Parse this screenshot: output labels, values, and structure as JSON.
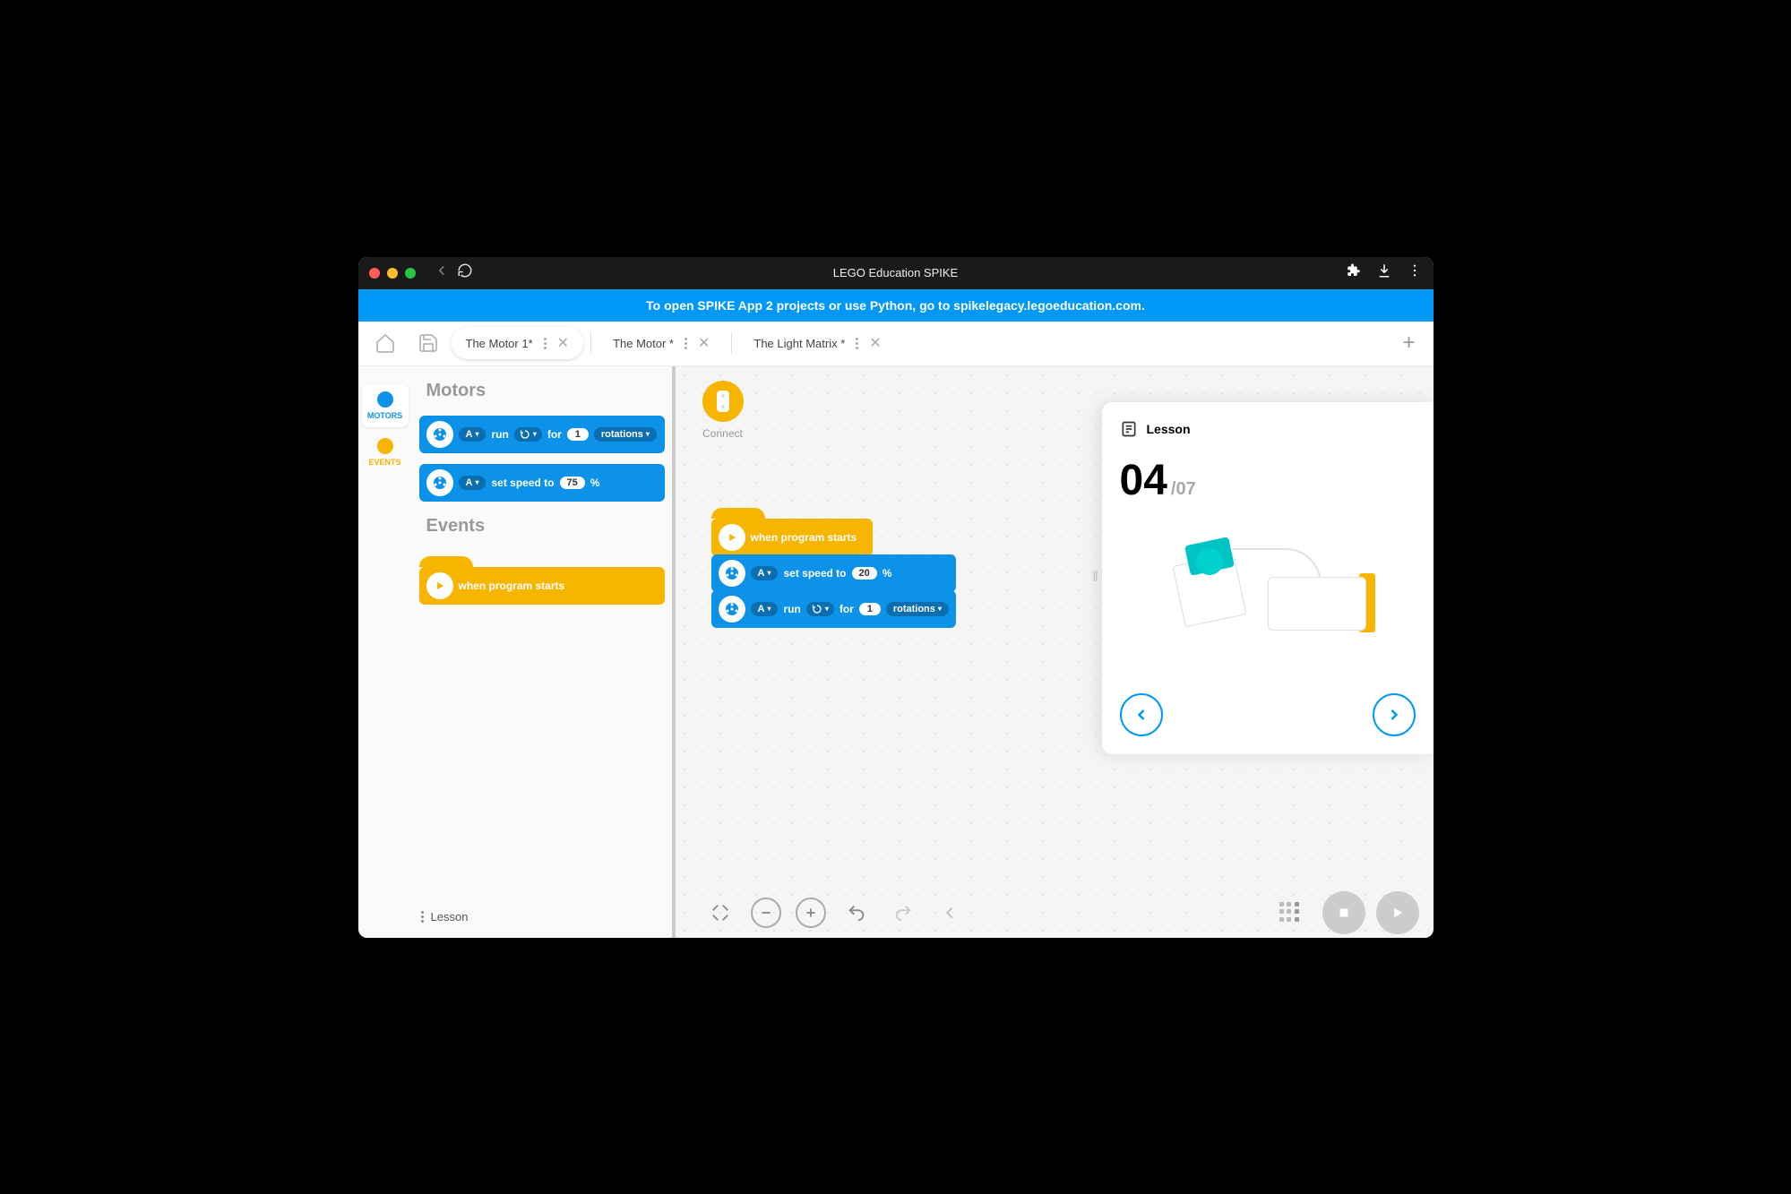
{
  "window": {
    "title": "LEGO Education SPIKE"
  },
  "banner": {
    "text": "To open SPIKE App 2 projects or use Python, go to spikelegacy.legoeducation.com."
  },
  "tabs": [
    {
      "label": "The Motor 1*",
      "active": true
    },
    {
      "label": "The Motor *",
      "active": false
    },
    {
      "label": "The Light Matrix *",
      "active": false
    }
  ],
  "categories": [
    {
      "label": "MOTORS",
      "color": "#0c92e8",
      "active": true
    },
    {
      "label": "EVENTS",
      "color": "#f8b500",
      "active": false
    }
  ],
  "palette": {
    "sections": [
      {
        "title": "Motors",
        "blocks": [
          {
            "type": "motor",
            "parts": [
              "port:A",
              "text:run",
              "dir:cw",
              "text:for",
              "num:1",
              "drop:rotations"
            ]
          },
          {
            "type": "motor",
            "parts": [
              "port:A",
              "text:set speed to",
              "num:75",
              "text:%"
            ]
          }
        ]
      },
      {
        "title": "Events",
        "blocks": [
          {
            "type": "event",
            "hat": true,
            "parts": [
              "text:when program starts"
            ]
          }
        ]
      }
    ]
  },
  "canvas": {
    "connect_label": "Connect",
    "stack": [
      {
        "type": "event",
        "hat": true,
        "parts": [
          "text:when program starts"
        ]
      },
      {
        "type": "motor",
        "parts": [
          "port:A",
          "text:set speed to",
          "num:20",
          "text:%"
        ]
      },
      {
        "type": "motor",
        "parts": [
          "port:A",
          "text:run",
          "dir:cw",
          "text:for",
          "num:1",
          "drop:rotations"
        ]
      }
    ]
  },
  "lesson": {
    "header": "Lesson",
    "current": "04",
    "total": "/07"
  },
  "bottom": {
    "lesson_label": "Lesson"
  }
}
